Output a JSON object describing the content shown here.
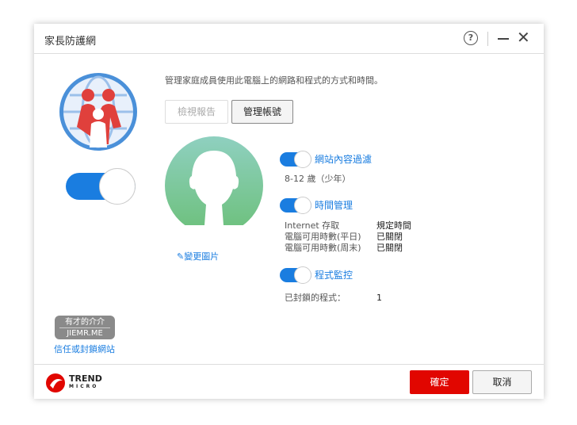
{
  "window": {
    "title": "家長防護網",
    "help_icon": "question-icon",
    "minimize_icon": "minimize-icon",
    "close_icon": "close-icon"
  },
  "description": "管理家庭成員使用此電腦上的網路和程式的方式和時間。",
  "buttons": {
    "view_report": "檢視報告",
    "manage_accounts": "管理帳號",
    "ok": "確定",
    "cancel": "取消"
  },
  "main_toggle": {
    "on": true
  },
  "profile": {
    "change_picture": "變更圖片"
  },
  "settings": {
    "web_filter": {
      "label": "網站內容過濾",
      "on": true,
      "value": "8-12 歲（少年）"
    },
    "time": {
      "label": "時間管理",
      "on": true,
      "rows": [
        {
          "k": "Internet 存取",
          "v": "規定時間"
        },
        {
          "k": "電腦可用時數(平日)",
          "v": "已關閉"
        },
        {
          "k": "電腦可用時數(周末)",
          "v": "已關閉"
        }
      ]
    },
    "program": {
      "label": "程式監控",
      "on": true,
      "k": "已封鎖的程式：",
      "v": "1"
    }
  },
  "trust_link": "信任或封鎖網站",
  "watermark": {
    "line1": "有才的介介",
    "line2": "JIEMR.ME"
  },
  "brand": {
    "line1": "TREND",
    "line2": "MICRO"
  },
  "colors": {
    "accent": "#1a7de0",
    "ok": "#e10600"
  }
}
